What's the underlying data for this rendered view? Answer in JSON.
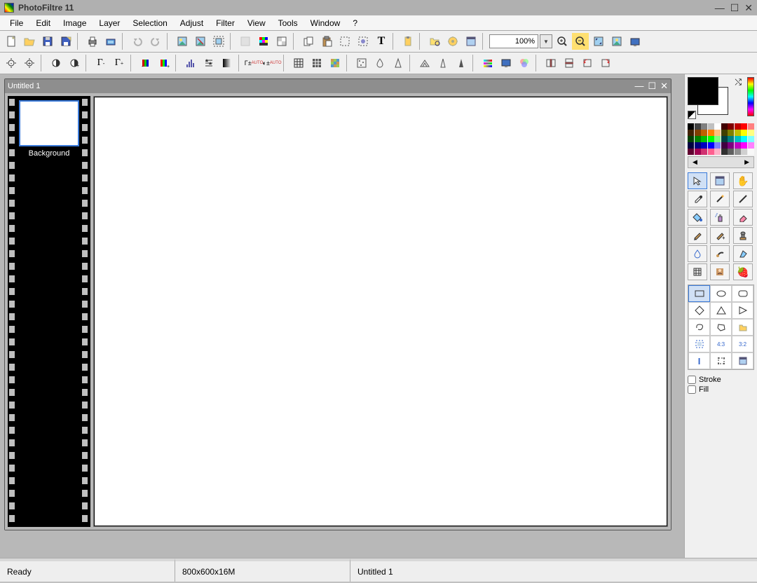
{
  "app": {
    "title": "PhotoFiltre 11"
  },
  "menu": [
    "File",
    "Edit",
    "Image",
    "Layer",
    "Selection",
    "Adjust",
    "Filter",
    "View",
    "Tools",
    "Window",
    "?"
  ],
  "toolbar": {
    "zoom": "100%"
  },
  "document": {
    "title": "Untitled 1",
    "layer": "Background"
  },
  "options": {
    "stroke": "Stroke",
    "fill": "Fill"
  },
  "status": {
    "state": "Ready",
    "dims": "800x600x16M",
    "docname": "Untitled 1"
  },
  "palette_colors": [
    "#000000",
    "#404040",
    "#808080",
    "#c0c0c0",
    "#ffffff",
    "#400000",
    "#800000",
    "#c00000",
    "#ff0000",
    "#ff8080",
    "#402000",
    "#804000",
    "#c06000",
    "#ff8000",
    "#ffc080",
    "#404000",
    "#808000",
    "#c0c000",
    "#ffff00",
    "#ffff80",
    "#004000",
    "#008000",
    "#00c000",
    "#00ff00",
    "#80ff80",
    "#004040",
    "#008080",
    "#00c0c0",
    "#00ffff",
    "#80ffff",
    "#000040",
    "#000080",
    "#0000c0",
    "#0000ff",
    "#8080ff",
    "#400040",
    "#800080",
    "#c000c0",
    "#ff00ff",
    "#ff80ff",
    "#600030",
    "#a00050",
    "#d03070",
    "#ff6090",
    "#ffb0c8",
    "#303030",
    "#606060",
    "#909090",
    "#d0d0d0",
    "#f8f8f8"
  ]
}
